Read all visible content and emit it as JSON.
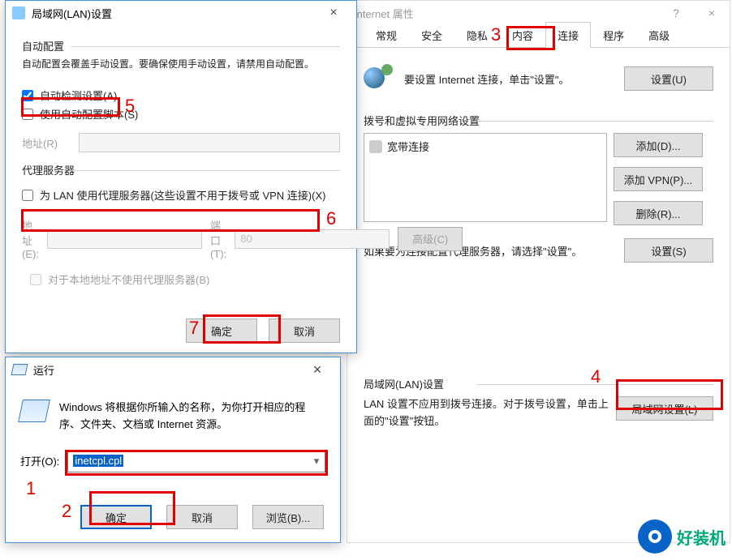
{
  "inetprops": {
    "title": "Internet 属性",
    "tabs": {
      "t0": "常规",
      "t1": "安全",
      "t2": "隐私",
      "t3": "内容",
      "t4": "连接",
      "t5": "程序",
      "t6": "高级"
    },
    "setup_hint": "要设置 Internet 连接，单击\"设置\"。",
    "setup_btn": "设置(U)",
    "dial_head": "拨号和虚拟专用网络设置",
    "conn0": "宽带连接",
    "add_btn": "添加(D)...",
    "addvpn_btn": "添加 VPN(P)...",
    "del_btn": "删除(R)...",
    "proxy_hint": "如果要为连接配置代理服务器，请选择\"设置\"。",
    "settings_btn": "设置(S)",
    "lan_head": "局域网(LAN)设置",
    "lan_hint": "LAN 设置不应用到拨号连接。对于拨号设置，单击上面的\"设置\"按钮。",
    "lan_btn": "局域网设置(L)"
  },
  "lan": {
    "title": "局域网(LAN)设置",
    "auto_head": "自动配置",
    "auto_note": "自动配置会覆盖手动设置。要确保使用手动设置，请禁用自动配置。",
    "auto_detect": "自动检测设置(A)",
    "auto_script": "使用自动配置脚本(S)",
    "addr_lbl": "地址(R)",
    "proxy_head": "代理服务器",
    "proxy_chk": "为 LAN 使用代理服务器(这些设置不用于拨号或 VPN 连接)(X)",
    "addr2_lbl": "地址(E):",
    "port_lbl": "端口(T):",
    "port_val": "80",
    "adv_btn": "高级(C)",
    "bypass": "对于本地地址不使用代理服务器(B)",
    "ok": "确定",
    "cancel": "取消"
  },
  "run": {
    "title": "运行",
    "desc": "Windows 将根据你所输入的名称，为你打开相应的程序、文件夹、文档或 Internet 资源。",
    "open_lbl": "打开(O):",
    "value": "inetcpl.cpl",
    "ok": "确定",
    "cancel": "取消",
    "browse": "浏览(B)..."
  },
  "anno": {
    "a1": "1",
    "a2": "2",
    "a3": "3",
    "a4": "4",
    "a5": "5",
    "a6": "6",
    "a7": "7"
  },
  "watermark": "好装机"
}
